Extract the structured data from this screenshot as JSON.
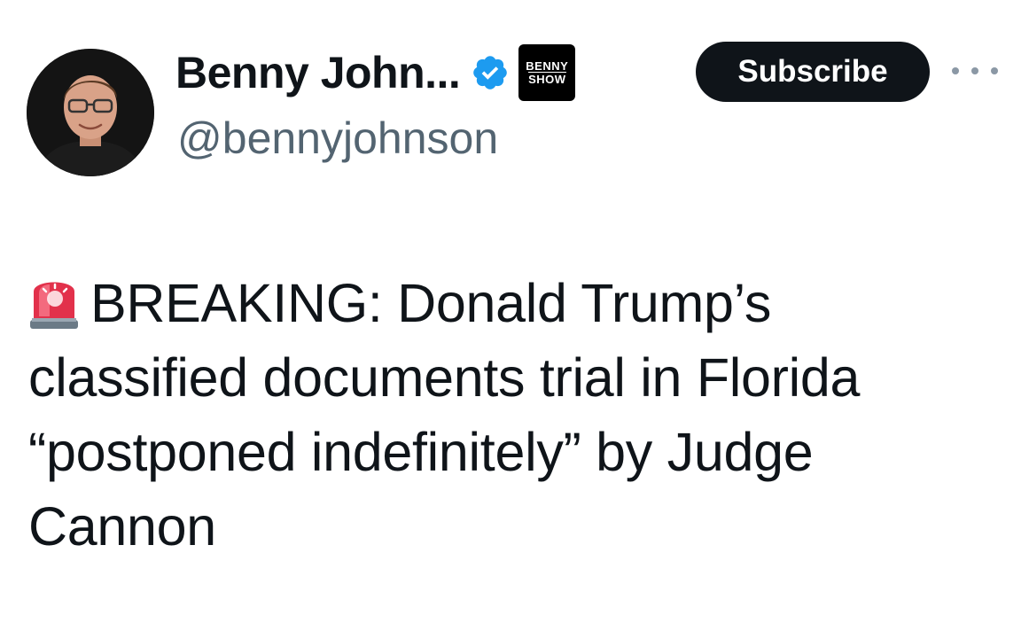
{
  "author": {
    "display_name": "Benny John...",
    "handle": "@bennyjohnson",
    "verified_icon": "verified-badge-icon",
    "affiliate_badge_line1": "BENNY",
    "affiliate_badge_line2": "SHOW",
    "avatar_icon": "avatar-photo"
  },
  "actions": {
    "subscribe_label": "Subscribe",
    "more_icon": "more-options-icon"
  },
  "tweet": {
    "emoji_icon": "police-siren-icon",
    "text": "BREAKING: Donald Trump’s classified documents trial in Florida “postponed indefinitely” by Judge Cannon"
  },
  "colors": {
    "text": "#0f1419",
    "secondary": "#536471",
    "verified_blue": "#1d9bf0",
    "button_bg": "#0f1419"
  }
}
